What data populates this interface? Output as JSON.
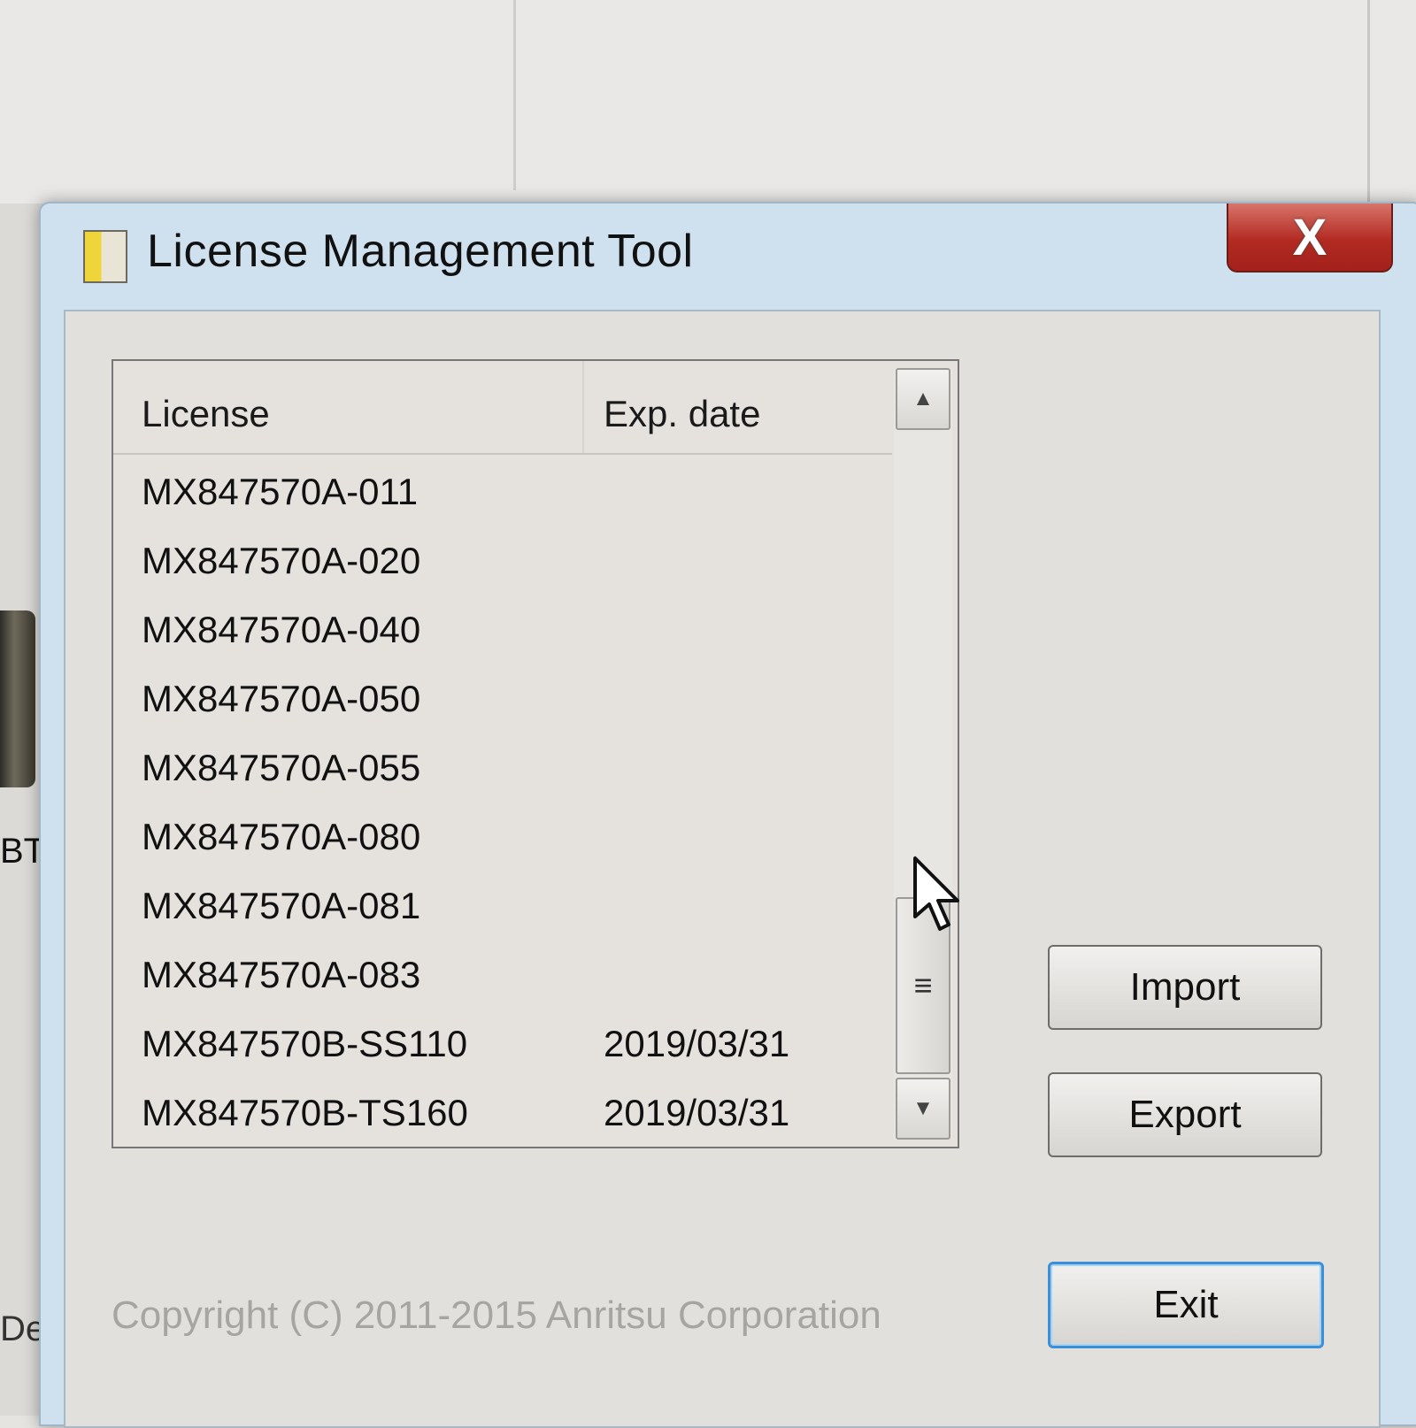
{
  "window": {
    "title": "License Management Tool",
    "close_label": "X"
  },
  "list": {
    "columns": {
      "license": "License",
      "exp_date": "Exp. date"
    },
    "rows": [
      {
        "license": "MX847570A-011",
        "exp": ""
      },
      {
        "license": "MX847570A-020",
        "exp": ""
      },
      {
        "license": "MX847570A-040",
        "exp": ""
      },
      {
        "license": "MX847570A-050",
        "exp": ""
      },
      {
        "license": "MX847570A-055",
        "exp": ""
      },
      {
        "license": "MX847570A-080",
        "exp": ""
      },
      {
        "license": "MX847570A-081",
        "exp": ""
      },
      {
        "license": "MX847570A-083",
        "exp": ""
      },
      {
        "license": "MX847570B-SS110",
        "exp": "2019/03/31"
      },
      {
        "license": "MX847570B-TS160",
        "exp": "2019/03/31"
      }
    ]
  },
  "buttons": {
    "import": "Import",
    "export": "Export",
    "exit": "Exit"
  },
  "footer": {
    "copyright": "Copyright (C) 2011-2015 Anritsu Corporation"
  },
  "background": {
    "left_text_1": "BT",
    "left_text_2": "De"
  },
  "colors": {
    "close_button": "#b22a22",
    "default_button_border": "#3a8fd6",
    "title_bar": "#cfe0ee"
  },
  "icons": {
    "app": "license-app-icon",
    "close": "close-icon",
    "scroll_up": "scroll-up-arrow-icon",
    "scroll_down": "scroll-down-arrow-icon",
    "cursor": "mouse-pointer-icon"
  }
}
